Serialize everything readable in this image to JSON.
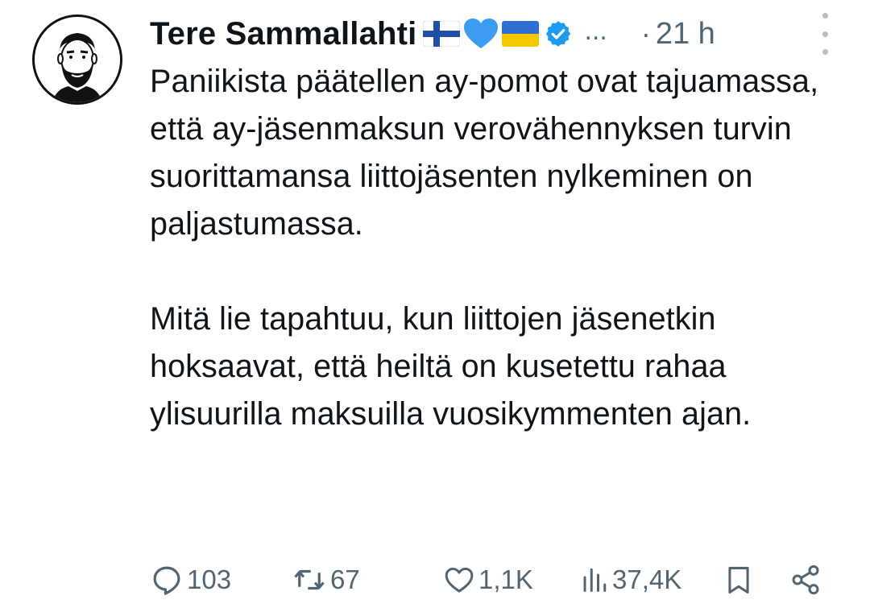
{
  "tweet": {
    "author_name": "Tere Sammallahti",
    "name_emojis": [
      "finland-flag-icon",
      "blue-heart-icon",
      "ukraine-flag-icon"
    ],
    "verified_badge": "verified-icon",
    "truncation": "...",
    "separator": "·",
    "timestamp": "21 h",
    "paragraphs": [
      "Paniikista päätellen ay-pomot ovat tajuamassa, että ay-jäsenmaksun verovähennyksen turvin suorittamansa liittojäsenten nylkeminen on paljastumassa.",
      "Mitä lie tapahtuu, kun liittojen jäsenetkin hoksaavat, että heiltä on kusetettu rahaa ylisuurilla maksuilla vuosikymmenten ajan."
    ]
  },
  "actions": {
    "replies": "103",
    "reposts": "67",
    "likes": "1,1K",
    "views": "37,4K"
  },
  "colors": {
    "text": "#0f1419",
    "secondary": "#536471",
    "verified": "#1d9bf0"
  }
}
